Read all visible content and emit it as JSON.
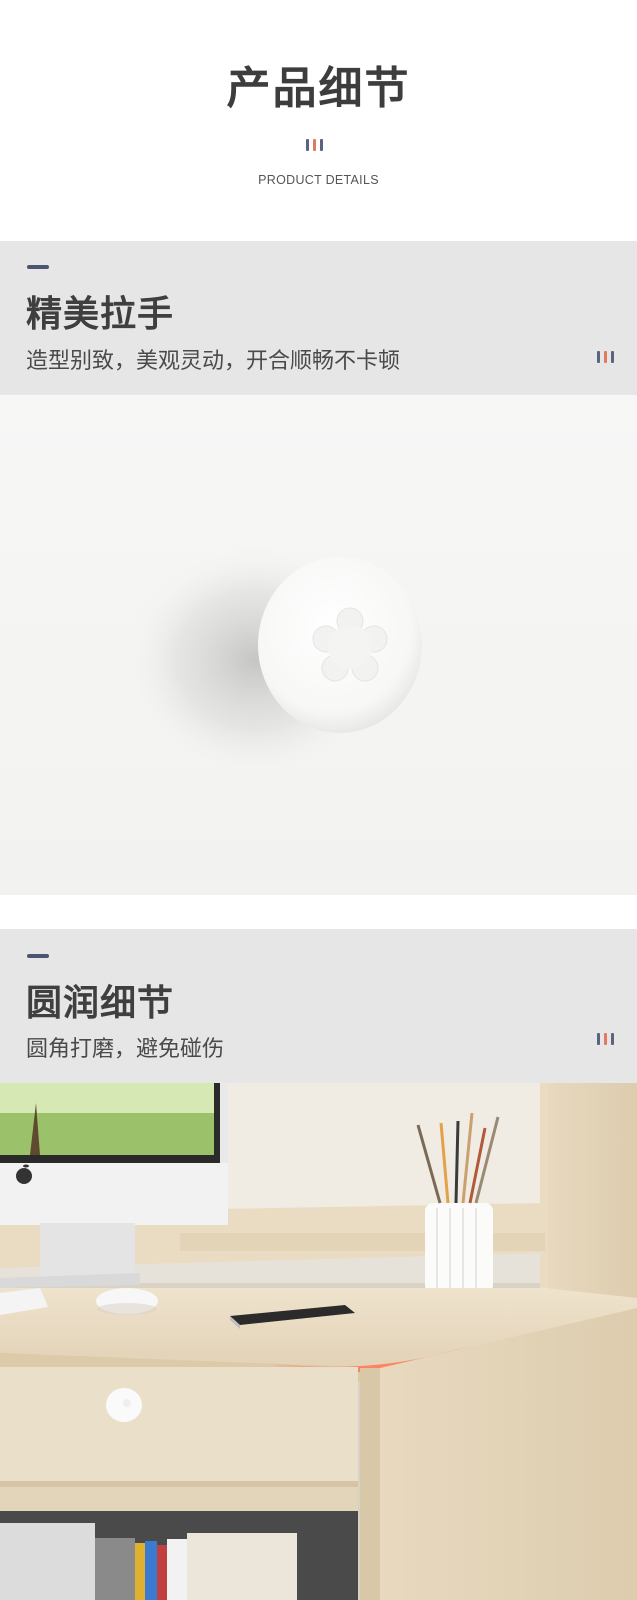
{
  "header": {
    "title": "产品细节",
    "subtitle": "PRODUCT DETAILS"
  },
  "accent_colors": [
    "#5a6482",
    "#e07a5f",
    "#5a6482"
  ],
  "sections": [
    {
      "title": "精美拉手",
      "desc": "造型别致，美观灵动，开合顺畅不卡顿"
    },
    {
      "title": "圆润细节",
      "desc": "圆角打磨，避免碰伤"
    }
  ],
  "icons": [
    "apple-logo-icon",
    "flower-emblem-icon"
  ]
}
